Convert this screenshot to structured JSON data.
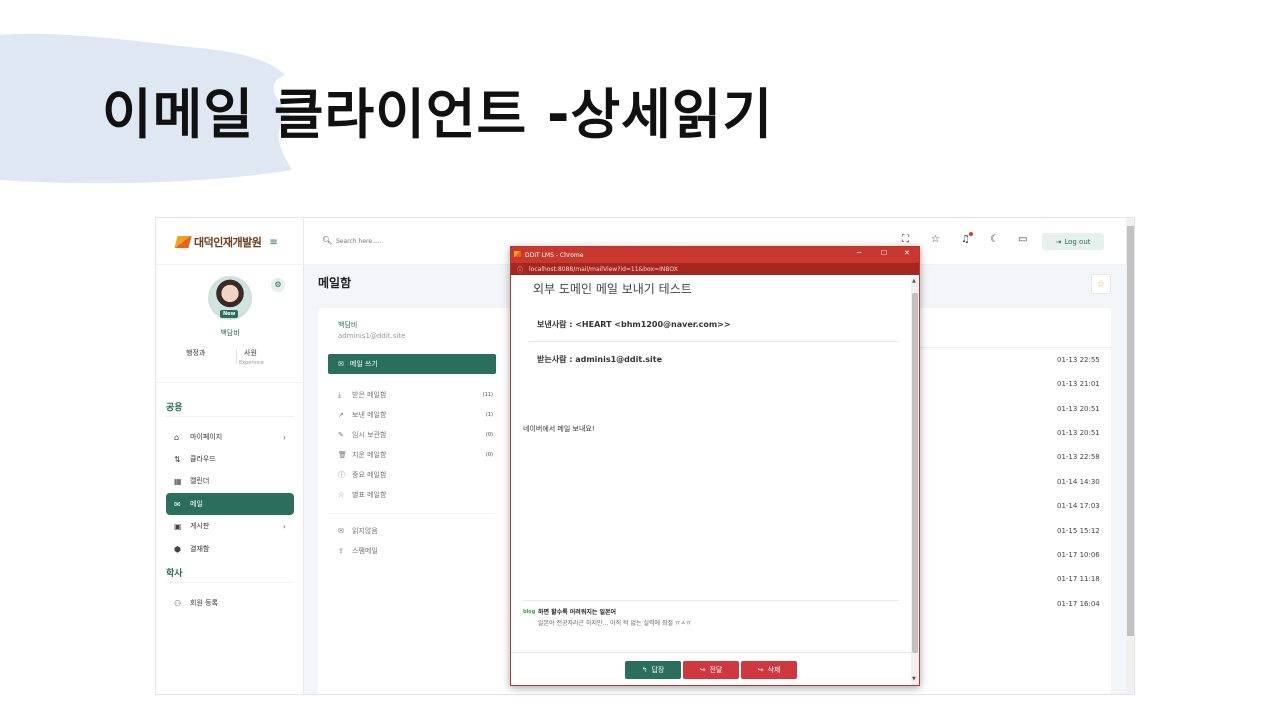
{
  "slide": {
    "title": "이메일 클라이언트 -상세읽기"
  },
  "app": {
    "logo": "대덕인재개발원",
    "search": {
      "placeholder": "Search here....."
    },
    "logout_label": "Log out",
    "page_title": "메일함"
  },
  "profile": {
    "badge": "New",
    "name": "백담비",
    "department": "행정과",
    "role": "사원",
    "role_sub": "Experince"
  },
  "sidebar": {
    "section_common": "공용",
    "section_academic": "학사",
    "items": [
      {
        "label": "마이페이지",
        "icon": "home-icon",
        "chevron": "›"
      },
      {
        "label": "클라우드",
        "icon": "cloud-icon",
        "chevron": ""
      },
      {
        "label": "캘린더",
        "icon": "calendar-icon",
        "chevron": ""
      },
      {
        "label": "메일",
        "icon": "mail-icon",
        "chevron": ""
      },
      {
        "label": "게시판",
        "icon": "board-icon",
        "chevron": "›"
      },
      {
        "label": "결재함",
        "icon": "box-icon",
        "chevron": ""
      }
    ],
    "academic_items": [
      {
        "label": "회원 등록",
        "icon": "user-add-icon"
      }
    ]
  },
  "mailbox": {
    "user_name": "백담비",
    "user_email": "adminis1@ddit.site",
    "compose_label": "메일 쓰기",
    "folders": [
      {
        "label": "받은 메일함",
        "count": "(11)"
      },
      {
        "label": "보낸 메일함",
        "count": "(1)"
      },
      {
        "label": "임시 보관함",
        "count": "(0)"
      },
      {
        "label": "지운 메일함",
        "count": "(0)"
      },
      {
        "label": "중요 메일함",
        "count": ""
      },
      {
        "label": "별표 메일함",
        "count": ""
      }
    ],
    "extra": [
      {
        "label": "읽지않음"
      },
      {
        "label": "스팸메일"
      }
    ]
  },
  "list": {
    "dates": [
      "01-13 22:55",
      "01-13 21:01",
      "01-13 20:51",
      "01-13 20:51",
      "01-13 22:58",
      "01-14 14:30",
      "01-14 17:03",
      "01-15 15:12",
      "01-17 10:06",
      "01-17 11:18",
      "01-17 16:04"
    ]
  },
  "popup": {
    "window_title": "DDIT LMS - Chrome",
    "url": "localhost:8088/mail/mailView?id=11&box=INBOX",
    "subject": "외부 도메인 메일 보내기 테스트",
    "from": "보낸사람 : <HEART <bhm1200@naver.com>>",
    "to": "받는사람 : adminis1@ddit.site",
    "body": "네이버에서 메일 보내요!",
    "blog_badge": "blog",
    "blog_title": "하면 할수록 어려워지는 일본어",
    "blog_excerpt": "일본어 전공자라곤 하지만... 아직 턱 없는 실력에 좌절 ㅠㅅㅠ",
    "reply_label": "답장",
    "forward_label": "전달",
    "delete_label": "삭제"
  },
  "colors": {
    "brand": "#2a6e5c",
    "danger": "#d03841",
    "chrome": "#c9382e"
  }
}
